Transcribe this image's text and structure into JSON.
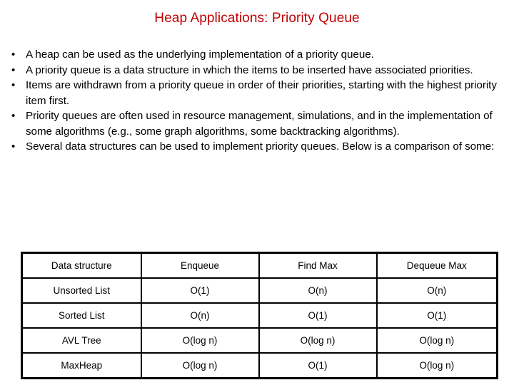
{
  "slide": {
    "title": "Heap Applications: Priority Queue",
    "title_color": "#bf0000",
    "background_color": "#ffffff",
    "text_color": "#000000"
  },
  "bullets": [
    {
      "marker": "•",
      "text": "A heap can be used as the underlying implementation of a priority queue."
    },
    {
      "marker": "•",
      "text": "A priority queue is a data structure in which the items to be inserted have associated priorities."
    },
    {
      "marker": "•",
      "text": "Items are withdrawn from a priority queue in order of their priorities, starting with the highest priority item first."
    },
    {
      "marker": "•",
      "text": "Priority queues are often used in resource management, simulations, and in the implementation of some algorithms (e.g., some graph algorithms, some backtracking algorithms)."
    },
    {
      "marker": "•",
      "text": "Several data structures can be used to implement priority queues. Below is a comparison of some:"
    }
  ],
  "comparison_table": {
    "headers": [
      "Data structure",
      "Enqueue",
      "Find Max",
      "Dequeue Max"
    ],
    "rows": [
      [
        "Unsorted List",
        "O(1)",
        "O(n)",
        "O(n)"
      ],
      [
        "Sorted List",
        "O(n)",
        "O(1)",
        "O(1)"
      ],
      [
        "AVL Tree",
        "O(log n)",
        "O(log n)",
        "O(log n)"
      ],
      [
        "MaxHeap",
        "O(log n)",
        "O(1)",
        "O(log n)"
      ]
    ]
  }
}
